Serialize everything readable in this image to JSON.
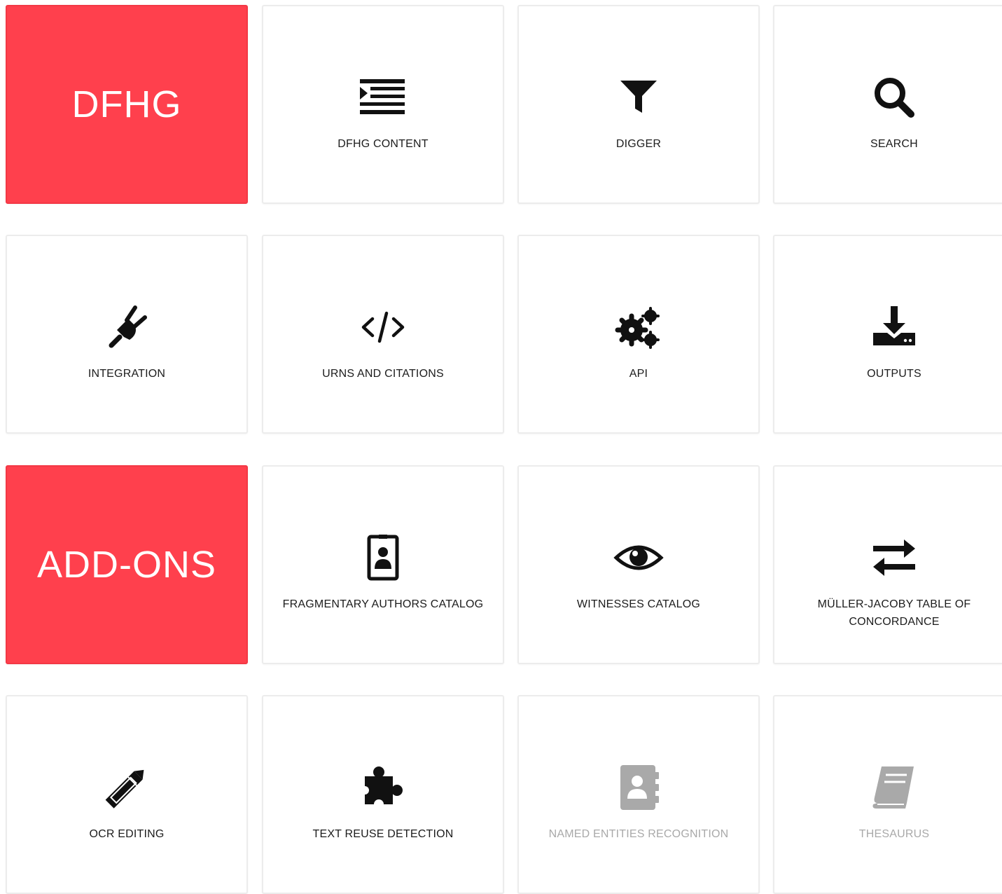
{
  "colors": {
    "accent": "#ff404d",
    "icon": "#111111",
    "disabled": "#a9a9a9",
    "text": "#1c1c1c"
  },
  "sections": {
    "dfhg": "DFHG",
    "addons": "ADD-ONS"
  },
  "tiles": {
    "dfhg_content": {
      "label": "DFHG CONTENT",
      "icon": "indent-list-icon"
    },
    "digger": {
      "label": "DIGGER",
      "icon": "filter-icon"
    },
    "search": {
      "label": "SEARCH",
      "icon": "search-icon"
    },
    "integration": {
      "label": "INTEGRATION",
      "icon": "plug-icon"
    },
    "urns": {
      "label": "URNS AND CITATIONS",
      "icon": "code-icon"
    },
    "api": {
      "label": "API",
      "icon": "gears-icon"
    },
    "outputs": {
      "label": "OUTPUTS",
      "icon": "download-icon"
    },
    "authors": {
      "label": "FRAGMENTARY AUTHORS CATALOG",
      "icon": "id-badge-icon"
    },
    "witnesses": {
      "label": "WITNESSES CATALOG",
      "icon": "eye-icon"
    },
    "muller": {
      "label": "MÜLLER-JACOBY TABLE OF CONCORDANCE",
      "icon": "exchange-icon"
    },
    "ocr": {
      "label": "OCR EDITING",
      "icon": "pencil-icon"
    },
    "reuse": {
      "label": "TEXT REUSE DETECTION",
      "icon": "puzzle-icon"
    },
    "ner": {
      "label": "NAMED ENTITIES RECOGNITION",
      "icon": "address-book-icon"
    },
    "thesaurus": {
      "label": "THESAURUS",
      "icon": "book-icon"
    }
  }
}
